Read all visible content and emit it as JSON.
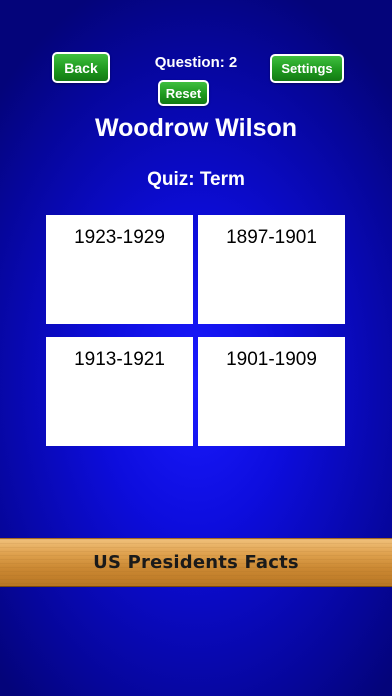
{
  "toolbar": {
    "back_label": "Back",
    "settings_label": "Settings",
    "reset_label": "Reset",
    "question_label": "Question: 2"
  },
  "quiz": {
    "president_name": "Woodrow Wilson",
    "quiz_type": "Quiz: Term",
    "answers": [
      "1923-1929",
      "1897-1901",
      "1913-1921",
      "1901-1909"
    ]
  },
  "banner": {
    "text": "US Presidents Facts"
  },
  "colors": {
    "background": "#0d0ddd",
    "button_green": "#1f9a1f",
    "banner_wood": "#e0a350"
  }
}
